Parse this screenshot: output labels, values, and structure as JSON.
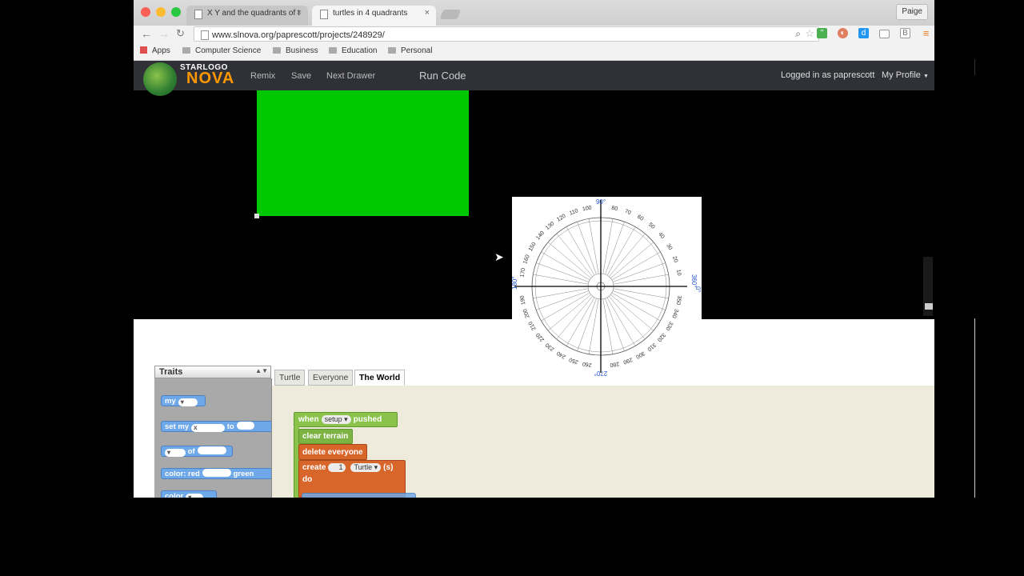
{
  "browser": {
    "tabs": [
      {
        "title": "X Y and the quadrants of t",
        "active": false
      },
      {
        "title": "turtles in 4 quadrants",
        "active": true
      }
    ],
    "user": "Paige",
    "url": "www.slnova.org/paprescott/projects/248929/",
    "bookmarks": {
      "apps": "Apps",
      "items": [
        "Computer Science",
        "Business",
        "Education",
        "Personal"
      ]
    },
    "colors": {
      "tab_active": "#f5f5f5",
      "toolbar": "#f2f2f2"
    }
  },
  "site": {
    "logo_top": "STARLOGO",
    "logo_bottom": "NOVA",
    "nav": [
      "Remix",
      "Save",
      "Next Drawer"
    ],
    "run_code": "Run Code",
    "logged_in": "Logged in as paprescott",
    "my_profile": "My Profile",
    "colors": {
      "header_bg": "#2f3136",
      "logo_accent": "#ff9800",
      "terrain": "#00c800"
    }
  },
  "editor": {
    "traits_label": "Traits",
    "tabs": [
      "Turtle",
      "Everyone",
      "The World"
    ],
    "selected_tab": "The World",
    "palette": {
      "my": "my",
      "set_my": "set my",
      "set_my_value": "x",
      "to": "to",
      "of": "of",
      "color_red": "color: red",
      "green": "green",
      "color": "color"
    },
    "script": {
      "when": "when",
      "setup": "setup",
      "pushed": "pushed",
      "clear_terrain": "clear terrain",
      "delete_everyone": "delete everyone",
      "create": "create",
      "create_count": "1",
      "create_breed": "Turtle",
      "create_suffix": "(s)",
      "do": "do"
    }
  },
  "protractor": {
    "labels": [
      "90°",
      "0°",
      "360°",
      "180°",
      "270°"
    ]
  }
}
